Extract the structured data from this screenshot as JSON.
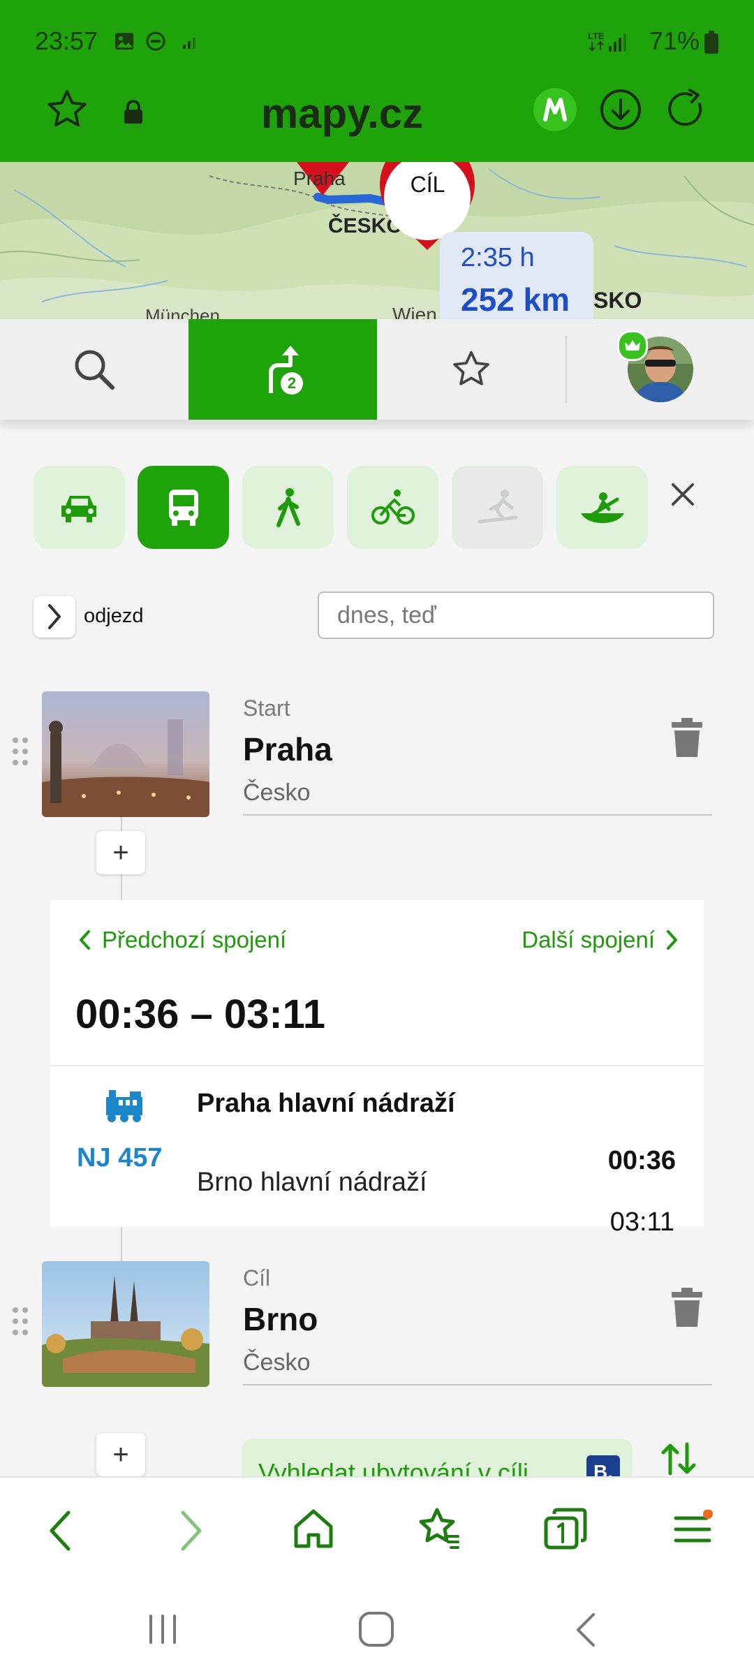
{
  "status_bar": {
    "time": "23:57",
    "battery": "71%"
  },
  "browser": {
    "url": "mapy.cz",
    "icons": [
      "star-outline-icon",
      "lock-icon",
      "mapy-m-icon",
      "download-icon",
      "reload-icon"
    ]
  },
  "map": {
    "labels": {
      "praha": "Praha",
      "cesko": "ČESKO",
      "munchen": "München",
      "wien": "Wien",
      "slovensko": "SKO"
    },
    "destination_badge": "CÍL",
    "route_duration": "2:35 h",
    "route_distance": "252 km"
  },
  "tabs": {
    "route_badge": "2",
    "items": [
      "search-icon",
      "route-icon",
      "favorites-icon",
      "profile-avatar"
    ]
  },
  "modes": [
    "car",
    "public-transport",
    "walk",
    "bike",
    "ski",
    "boat"
  ],
  "departure": {
    "label": "odjezd",
    "placeholder": "dnes, teď"
  },
  "start": {
    "kind": "Start",
    "name": "Praha",
    "country": "Česko"
  },
  "connection": {
    "prev": "Předchozí spojení",
    "next": "Další spojení",
    "time_range": "00:36 – 03:11",
    "train": "NJ 457",
    "from": "Praha hlavní nádraží",
    "to": "Brno hlavní nádraží",
    "dep_time": "00:36",
    "arr_time": "03:11"
  },
  "destination": {
    "kind": "Cíl",
    "name": "Brno",
    "country": "Česko"
  },
  "accommodation": {
    "label": "Vyhledat ubytování v cíli",
    "badge": "B."
  },
  "add_symbol": "+",
  "colors": {
    "brand_green": "#1ea40a",
    "link_green": "#1e9a0b",
    "train_blue": "#1c86c8",
    "route_blue": "#2a68d8",
    "pin_red": "#d4111c"
  }
}
